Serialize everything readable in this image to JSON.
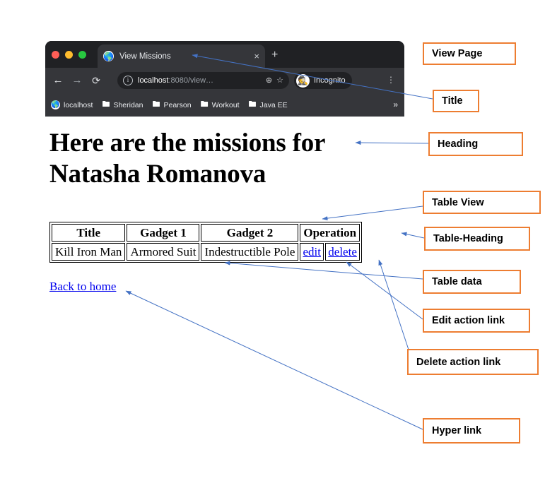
{
  "browser": {
    "window_controls": [
      "close",
      "minimize",
      "maximize"
    ],
    "tab": {
      "favicon": "globe-icon",
      "title": "View Missions",
      "close_label": "×"
    },
    "new_tab_label": "+",
    "toolbar": {
      "back_label": "←",
      "forward_label": "→",
      "reload_label": "⟳",
      "site_info_label": "i",
      "url_host": "localhost",
      "url_rest": ":8080/view…",
      "zoom_label": "⊕",
      "bookmark_star_label": "☆",
      "profile_label": "Incognito",
      "profile_avatar": "incognito-hat-icon",
      "menu_label": "⋮"
    },
    "bookmarks": [
      {
        "icon": "globe-icon",
        "label": "localhost"
      },
      {
        "icon": "folder-icon",
        "label": "Sheridan"
      },
      {
        "icon": "folder-icon",
        "label": "Pearson"
      },
      {
        "icon": "folder-icon",
        "label": "Workout"
      },
      {
        "icon": "folder-icon",
        "label": "Java EE"
      }
    ],
    "bookmarks_overflow_label": "»"
  },
  "page": {
    "heading": "Here are the missions for Natasha Romanova",
    "table": {
      "headers": [
        "Title",
        "Gadget 1",
        "Gadget 2",
        "Operation"
      ],
      "rows": [
        {
          "title": "Kill Iron Man",
          "gadget1": "Armored Suit",
          "gadget2": "Indestructible Pole",
          "edit_label": "edit",
          "delete_label": "delete"
        }
      ]
    },
    "back_link_label": "Back to home"
  },
  "annotations": [
    {
      "id": "view-page",
      "label": "View Page"
    },
    {
      "id": "title",
      "label": "Title"
    },
    {
      "id": "heading",
      "label": "Heading"
    },
    {
      "id": "table-view",
      "label": "Table View"
    },
    {
      "id": "table-heading",
      "label": "Table-Heading"
    },
    {
      "id": "table-data",
      "label": "Table data"
    },
    {
      "id": "edit-action-link",
      "label": "Edit action link"
    },
    {
      "id": "delete-action-link",
      "label": "Delete action link"
    },
    {
      "id": "hyper-link",
      "label": "Hyper link"
    }
  ],
  "colors": {
    "callout_border": "#ED7D31",
    "connector_line": "#4472C4",
    "browser_chrome": "#35363A",
    "browser_tabstrip": "#202124",
    "link": "#0000EE"
  }
}
